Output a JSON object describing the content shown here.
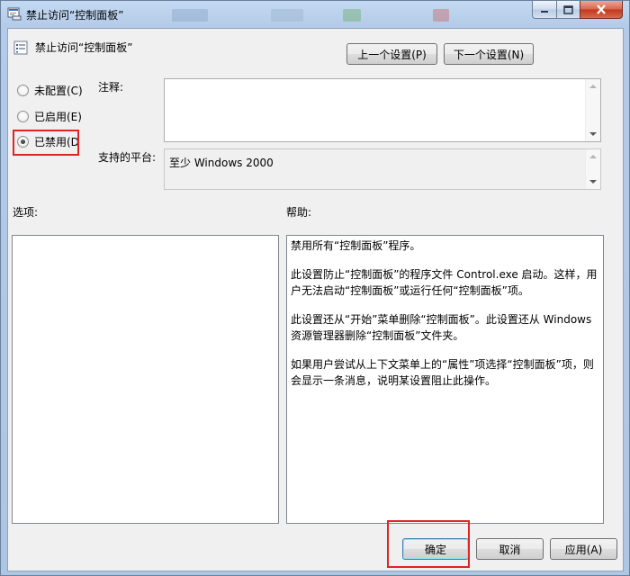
{
  "window": {
    "title": "禁止访问“控制面板”"
  },
  "header": {
    "policy_title": "禁止访问“控制面板”",
    "prev_setting": "上一个设置(P)",
    "next_setting": "下一个设置(N)"
  },
  "state_options": [
    {
      "label": "未配置(C)",
      "checked": false
    },
    {
      "label": "已启用(E)",
      "checked": false
    },
    {
      "label": "已禁用(D",
      "checked": true
    }
  ],
  "comment": {
    "label": "注释:",
    "value": ""
  },
  "platform": {
    "label": "支持的平台:",
    "value": "至少 Windows 2000"
  },
  "options": {
    "label": "选项:"
  },
  "help": {
    "label": "帮助:",
    "paragraphs": [
      "禁用所有“控制面板”程序。",
      "此设置防止“控制面板”的程序文件 Control.exe 启动。这样，用户无法启动“控制面板”或运行任何“控制面板”项。",
      "此设置还从“开始”菜单删除“控制面板”。此设置还从 Windows 资源管理器删除“控制面板”文件夹。",
      "如果用户尝试从上下文菜单上的“属性”项选择“控制面板”项，则会显示一条消息，说明某设置阻止此操作。"
    ]
  },
  "footer": {
    "ok": "确定",
    "cancel": "取消",
    "apply": "应用(A)"
  },
  "colors": {
    "highlight": "#e02424",
    "frame": "#adc6e4"
  }
}
